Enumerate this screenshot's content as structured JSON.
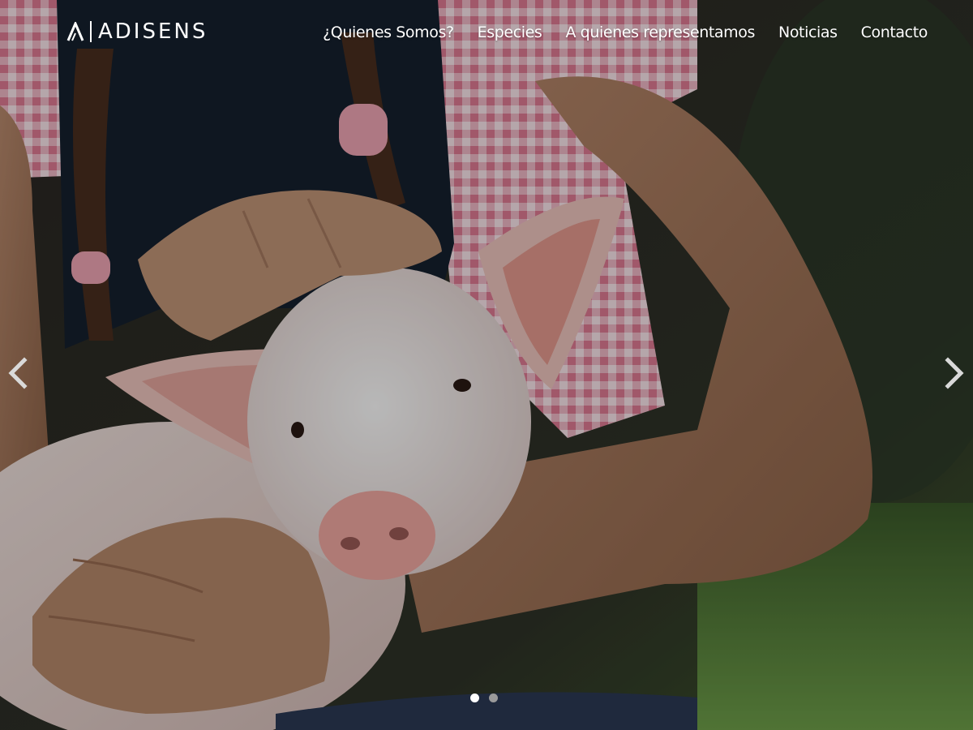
{
  "brand": {
    "name": "ADISENS",
    "logo_icon": "stylized-a-logo-icon"
  },
  "nav": {
    "items": [
      {
        "label": "¿Quienes Somos?"
      },
      {
        "label": "Especies"
      },
      {
        "label": "A quienes representamos"
      },
      {
        "label": "Noticias"
      },
      {
        "label": "Contacto"
      }
    ]
  },
  "slider": {
    "prev_icon": "chevron-left-icon",
    "next_icon": "chevron-right-icon",
    "slides_total": 2,
    "active_slide": 1,
    "image_subject": "child holding a piglet"
  },
  "colors": {
    "nav_text": "#ffffff",
    "dot_active": "#ffffff",
    "dot_inactive": "#9a9a9a",
    "overlay": "#000000"
  }
}
